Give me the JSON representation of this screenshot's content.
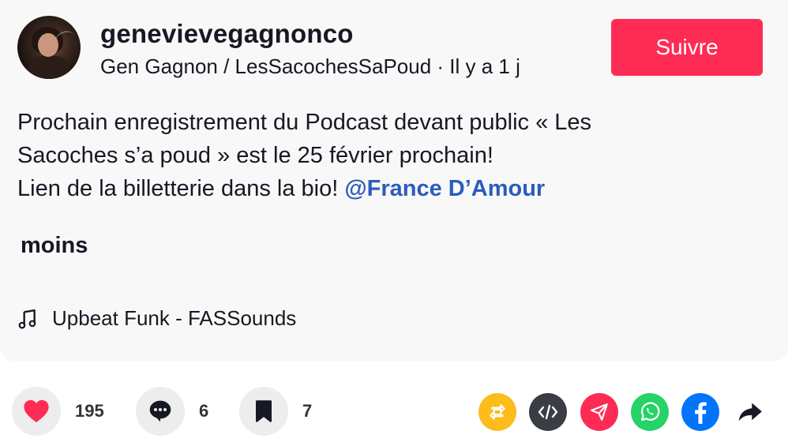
{
  "post": {
    "username": "genevievegagnonco",
    "author_line": "Gen Gagnon / LesSacochesSaPoud · Il y a 1 j",
    "follow_label": "Suivre",
    "caption_line1": "Prochain enregistrement du Podcast devant public « Les",
    "caption_line2": "Sacoches s’a poud » est le 25 février prochain!",
    "caption_line3": "Lien de la billetterie dans la bio! ",
    "mention": "@France D’Amour",
    "less_label": "moins",
    "music_label": "Upbeat Funk - FASSounds"
  },
  "actions": {
    "likes": "195",
    "comments": "6",
    "saves": "7"
  },
  "share": [
    {
      "name": "repost-icon",
      "color": "#fbbc1c"
    },
    {
      "name": "embed-icon",
      "color": "#3b3d45"
    },
    {
      "name": "send-icon",
      "color": "#fe2c55"
    },
    {
      "name": "whatsapp-icon",
      "color": "#25d366"
    },
    {
      "name": "facebook-icon",
      "color": "#0075fa"
    },
    {
      "name": "share-arrow-icon",
      "color": "#161823"
    }
  ],
  "colors": {
    "accent": "#fe2c55",
    "mention": "#2b5db9",
    "like": "#fe2c55"
  }
}
